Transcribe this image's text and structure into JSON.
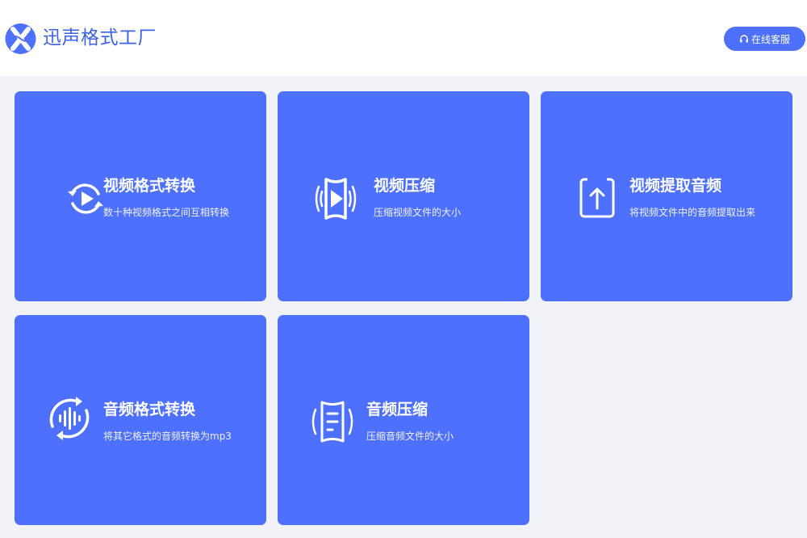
{
  "header": {
    "app_title": "迅声格式工厂",
    "service_button_label": "在线客服",
    "logo_icon": "x-waveform-logo",
    "service_icon": "headset-icon"
  },
  "colors": {
    "card_background": "#4e70ff",
    "brand_text": "#3c61e6",
    "page_background": "#f2f3f8"
  },
  "cards": [
    {
      "icon": "video-convert-icon",
      "title": "视频格式转换",
      "desc": "数十种视频格式之间互相转换"
    },
    {
      "icon": "video-compress-icon",
      "title": "视频压缩",
      "desc": "压缩视频文件的大小"
    },
    {
      "icon": "audio-extract-icon",
      "title": "视频提取音频",
      "desc": "将视频文件中的音频提取出来"
    },
    {
      "icon": "audio-convert-icon",
      "title": "音频格式转换",
      "desc": "将其它格式的音频转换为mp3"
    },
    {
      "icon": "audio-compress-icon",
      "title": "音频压缩",
      "desc": "压缩音频文件的大小"
    }
  ]
}
